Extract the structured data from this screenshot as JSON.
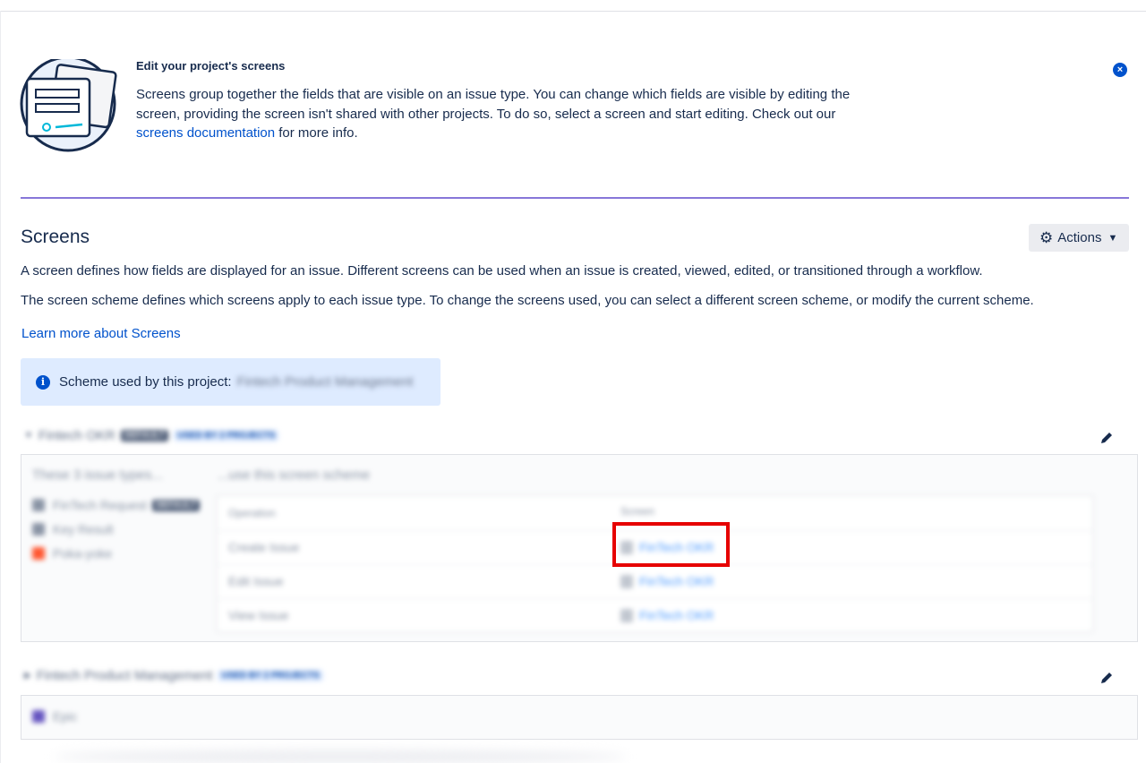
{
  "intro": {
    "title": "Edit your project's screens",
    "body_prefix": "Screens group together the fields that are visible on an issue type. You can change which fields are visible by editing the screen, providing the screen isn't shared with other projects. To do so, select a screen and start editing. Check out our ",
    "link_text": "screens documentation",
    "body_suffix": " for more info.",
    "close_icon": "close-icon",
    "accent_color": "#8777d9"
  },
  "screens": {
    "title": "Screens",
    "actions_label": "Actions",
    "description_1": "A screen defines how fields are displayed for an issue. Different screens can be used when an issue is created, viewed, edited, or transitioned through a workflow.",
    "description_2": "The screen scheme defines which screens apply to each issue type. To change the screens used, you can select a different screen scheme, or modify the current scheme.",
    "learn_more": "Learn more about Screens",
    "scheme_used_label": "Scheme used by this project:",
    "scheme_used_value": "Fintech Product Management"
  },
  "scheme_blocks": [
    {
      "name": "Fintech OKR",
      "default_badge": "DEFAULT",
      "used_by_badge": "USED BY 2 PROJECTS",
      "issue_types_title": "These 3 issue types...",
      "screen_scheme_title": "...use this screen scheme",
      "issue_types": [
        {
          "label": "FinTech Request",
          "badge": "DEFAULT",
          "color": "#8993a4"
        },
        {
          "label": "Key Result",
          "color": "#8993a4"
        },
        {
          "label": "Poka-yoke",
          "color": "#ff5630"
        }
      ],
      "table_headers": {
        "operation": "Operation",
        "screen": "Screen"
      },
      "operations": [
        {
          "operation": "Create Issue",
          "screen": "FinTech OKR"
        },
        {
          "operation": "Edit Issue",
          "screen": "FinTech OKR"
        },
        {
          "operation": "View Issue",
          "screen": "FinTech OKR"
        }
      ]
    },
    {
      "name": "Fintech Product Management",
      "used_by_badge": "USED BY 2 PROJECTS",
      "issue_types": [
        {
          "label": "Epic",
          "color": "#6554c0"
        }
      ]
    }
  ],
  "colors": {
    "link": "#0052cc",
    "info_bg": "#deebff",
    "highlight": "#e60000"
  }
}
